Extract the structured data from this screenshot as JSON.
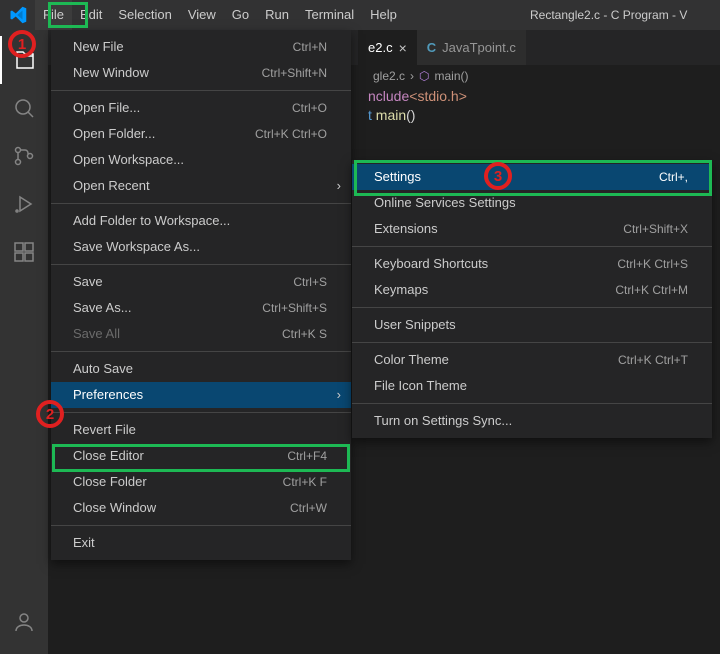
{
  "window": {
    "title": "Rectangle2.c - C Program - V"
  },
  "menubar": [
    "File",
    "Edit",
    "Selection",
    "View",
    "Go",
    "Run",
    "Terminal",
    "Help"
  ],
  "tabs": [
    {
      "label": "e2.c",
      "active": true
    },
    {
      "label": "JavaTpoint.c",
      "active": false
    }
  ],
  "breadcrumb": {
    "file": "gle2.c",
    "symbol": "main()"
  },
  "code": {
    "l1a": "nclude",
    "l1b": "<stdio.h>",
    "l2a": "t ",
    "l2b": "main",
    "l2c": "()"
  },
  "fileMenu": [
    {
      "label": "New File",
      "kbd": "Ctrl+N"
    },
    {
      "label": "New Window",
      "kbd": "Ctrl+Shift+N"
    },
    {
      "sep": true
    },
    {
      "label": "Open File...",
      "kbd": "Ctrl+O"
    },
    {
      "label": "Open Folder...",
      "kbd": "Ctrl+K Ctrl+O"
    },
    {
      "label": "Open Workspace..."
    },
    {
      "label": "Open Recent",
      "submenu": true
    },
    {
      "sep": true
    },
    {
      "label": "Add Folder to Workspace..."
    },
    {
      "label": "Save Workspace As..."
    },
    {
      "sep": true
    },
    {
      "label": "Save",
      "kbd": "Ctrl+S"
    },
    {
      "label": "Save As...",
      "kbd": "Ctrl+Shift+S"
    },
    {
      "label": "Save All",
      "kbd": "Ctrl+K S",
      "disabled": true
    },
    {
      "sep": true
    },
    {
      "label": "Auto Save"
    },
    {
      "label": "Preferences",
      "submenu": true,
      "highlight": true
    },
    {
      "sep": true
    },
    {
      "label": "Revert File"
    },
    {
      "label": "Close Editor",
      "kbd": "Ctrl+F4"
    },
    {
      "label": "Close Folder",
      "kbd": "Ctrl+K F"
    },
    {
      "label": "Close Window",
      "kbd": "Ctrl+W"
    },
    {
      "sep": true
    },
    {
      "label": "Exit"
    }
  ],
  "prefMenu": [
    {
      "label": "Settings",
      "kbd": "Ctrl+,",
      "highlight": true
    },
    {
      "label": "Online Services Settings"
    },
    {
      "label": "Extensions",
      "kbd": "Ctrl+Shift+X"
    },
    {
      "sep": true
    },
    {
      "label": "Keyboard Shortcuts",
      "kbd": "Ctrl+K Ctrl+S"
    },
    {
      "label": "Keymaps",
      "kbd": "Ctrl+K Ctrl+M"
    },
    {
      "sep": true
    },
    {
      "label": "User Snippets"
    },
    {
      "sep": true
    },
    {
      "label": "Color Theme",
      "kbd": "Ctrl+K Ctrl+T"
    },
    {
      "label": "File Icon Theme"
    },
    {
      "sep": true
    },
    {
      "label": "Turn on Settings Sync..."
    }
  ],
  "annotations": {
    "1": "1",
    "2": "2",
    "3": "3"
  }
}
